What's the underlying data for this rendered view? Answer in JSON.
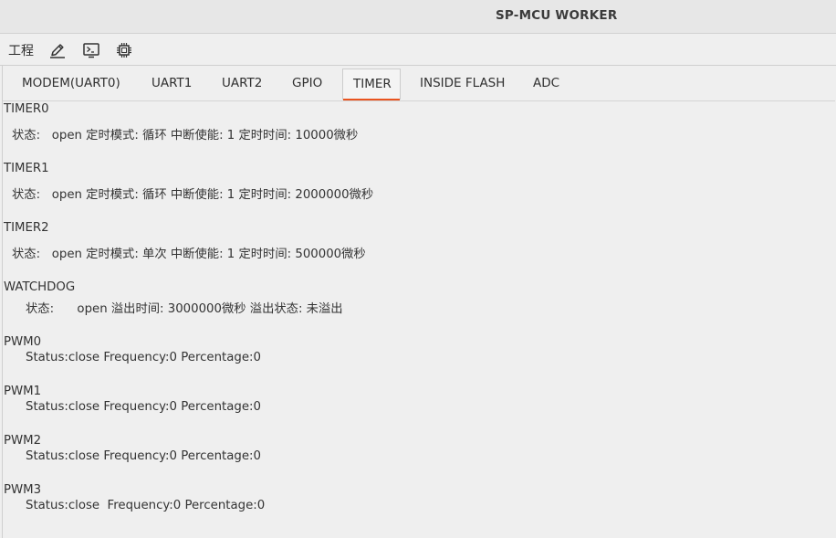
{
  "window": {
    "title": "SP-MCU WORKER"
  },
  "toolbar": {
    "menu_label": "工程",
    "tools": [
      {
        "icon": "pencil-icon"
      },
      {
        "icon": "terminal-icon"
      },
      {
        "icon": "chip-icon"
      }
    ]
  },
  "tabs": [
    {
      "label": "MODEM(UART0)"
    },
    {
      "label": "UART1"
    },
    {
      "label": "UART2"
    },
    {
      "label": "GPIO"
    },
    {
      "label": "TIMER",
      "active": true
    },
    {
      "label": "INSIDE FLASH"
    },
    {
      "label": "ADC"
    }
  ],
  "accent_color": "#e95420",
  "timers": [
    {
      "name": "TIMER0",
      "details": "状态:   open 定时模式: 循环 中断使能: 1 定时时间: 10000微秒"
    },
    {
      "name": "TIMER1",
      "details": "状态:   open 定时模式: 循环 中断使能: 1 定时时间: 2000000微秒"
    },
    {
      "name": "TIMER2",
      "details": "状态:   open 定时模式: 单次 中断使能: 1 定时时间: 500000微秒"
    }
  ],
  "watchdog": {
    "name": "WATCHDOG",
    "details": "状态:      open 溢出时间: 3000000微秒 溢出状态: 未溢出"
  },
  "pwms": [
    {
      "name": "PWM0",
      "details": "Status:close Frequency:0 Percentage:0"
    },
    {
      "name": "PWM1",
      "details": "Status:close Frequency:0 Percentage:0"
    },
    {
      "name": "PWM2",
      "details": "Status:close Frequency:0 Percentage:0"
    },
    {
      "name": "PWM3",
      "details": "Status:close  Frequency:0 Percentage:0"
    }
  ]
}
